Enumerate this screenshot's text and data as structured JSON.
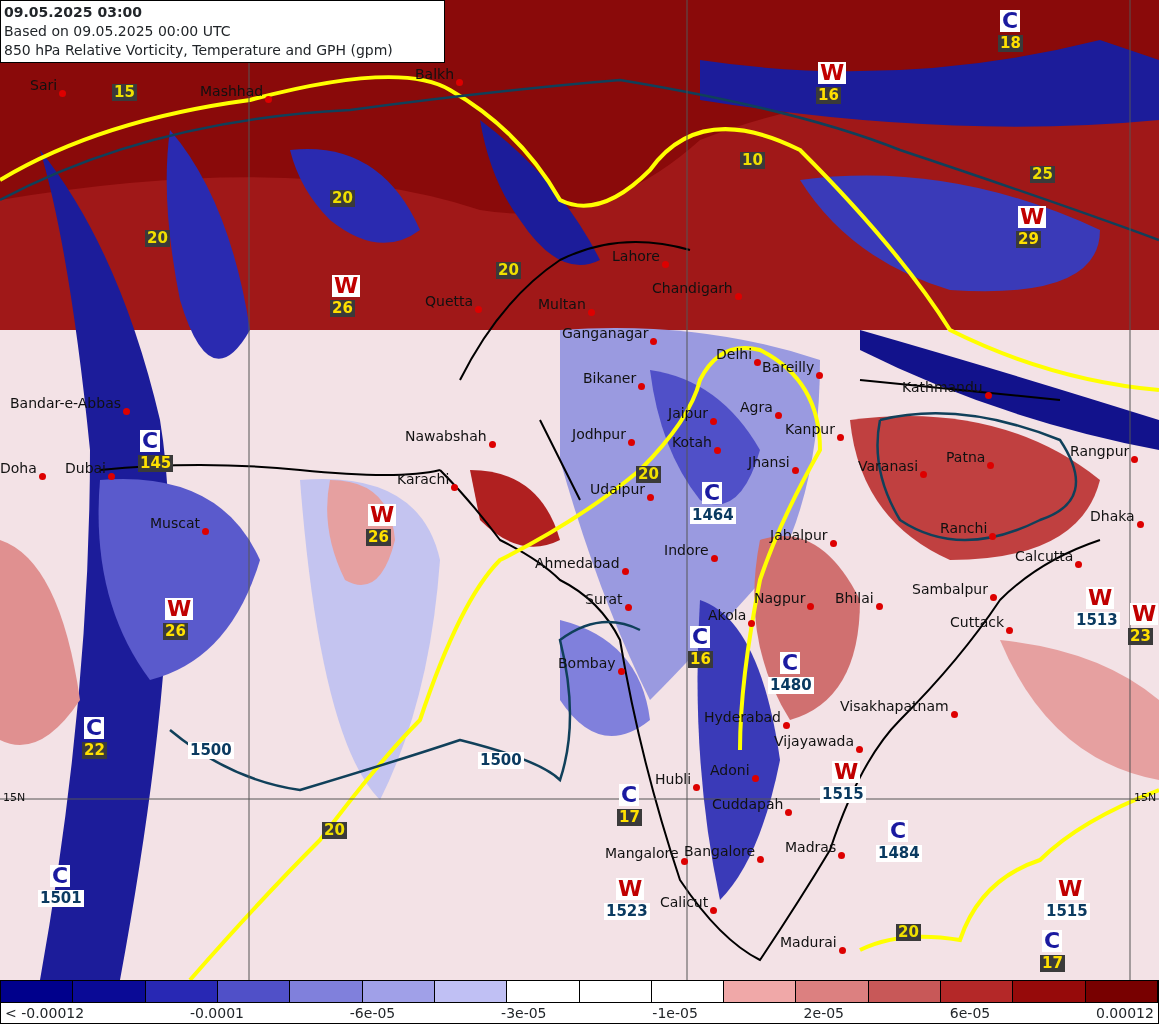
{
  "header": {
    "valid_time": "09.05.2025 03:00",
    "run": "Based on 09.05.2025 00:00 UTC",
    "field": "850 hPa Relative Vorticity, Temperature and GPH (gpm)"
  },
  "cities": [
    "Sari",
    "Mashhad",
    "Balkh",
    "Lahore",
    "Chandigarh",
    "Multan",
    "Quetta",
    "Ganganagar",
    "Bikaner",
    "Delhi",
    "Bareilly",
    "Jaipur",
    "Agra",
    "Kanpur",
    "Kathmandu",
    "Bandar-e-Abbas",
    "Nawabshah",
    "Jodhpur",
    "Kotah",
    "Jhansi",
    "Varanasi",
    "Patna",
    "Rangpur",
    "Doha",
    "Dubai",
    "Karachi",
    "Udaipur",
    "Dhaka",
    "Muscat",
    "Ranchi",
    "Jabalpur",
    "Indore",
    "Calcutta",
    "Ahmedabad",
    "Surat",
    "Nagpur",
    "Bhilai",
    "Sambalpur",
    "Akola",
    "Cuttack",
    "Bombay",
    "Visakhapatnam",
    "Hyderabad",
    "Vijayawada",
    "Adoni",
    "Hubli",
    "Cuddapah",
    "Mangalore",
    "Bangalore",
    "Madras",
    "Calicut",
    "Madurai"
  ],
  "systems": [
    {
      "kind": "cyclone",
      "letter": "C",
      "value": "18"
    },
    {
      "kind": "warm",
      "letter": "W",
      "value": "16"
    },
    {
      "kind": "warm",
      "letter": "W",
      "value": "29"
    },
    {
      "kind": "warm",
      "letter": "W",
      "value": "26"
    },
    {
      "kind": "cyclone",
      "letter": "C",
      "value": "145"
    },
    {
      "kind": "cyclone",
      "letter": "C",
      "value": "1464"
    },
    {
      "kind": "warm",
      "letter": "W",
      "value": "26"
    },
    {
      "kind": "warm",
      "letter": "W",
      "value": "26"
    },
    {
      "kind": "warm",
      "letter": "W",
      "value": "1513"
    },
    {
      "kind": "warm",
      "letter": "W",
      "value": "23"
    },
    {
      "kind": "cyclone",
      "letter": "C",
      "value": "16"
    },
    {
      "kind": "cyclone",
      "letter": "C",
      "value": "1480"
    },
    {
      "kind": "cyclone",
      "letter": "C",
      "value": "22"
    },
    {
      "kind": "warm",
      "letter": "W",
      "value": "1515"
    },
    {
      "kind": "cyclone",
      "letter": "C",
      "value": "17"
    },
    {
      "kind": "cyclone",
      "letter": "C",
      "value": "1484"
    },
    {
      "kind": "cyclone",
      "letter": "C",
      "value": "1501"
    },
    {
      "kind": "warm",
      "letter": "W",
      "value": "1523"
    },
    {
      "kind": "warm",
      "letter": "W",
      "value": "1515"
    },
    {
      "kind": "cyclone",
      "letter": "C",
      "value": "17"
    }
  ],
  "contour_labels": [
    {
      "kind": "temperature",
      "text": "15"
    },
    {
      "kind": "temperature",
      "text": "10"
    },
    {
      "kind": "temperature",
      "text": "25"
    },
    {
      "kind": "temperature",
      "text": "20"
    },
    {
      "kind": "temperature",
      "text": "20"
    },
    {
      "kind": "temperature",
      "text": "20"
    },
    {
      "kind": "temperature",
      "text": "20"
    },
    {
      "kind": "height",
      "text": "1500"
    },
    {
      "kind": "height",
      "text": "1500"
    },
    {
      "kind": "temperature",
      "text": "20"
    },
    {
      "kind": "temperature",
      "text": "20"
    }
  ],
  "latitude_labels": [
    "15N",
    "15N"
  ],
  "colorbar": {
    "bins": [
      {
        "color": "#00008c"
      },
      {
        "color": "#0a0a96"
      },
      {
        "color": "#2828b4"
      },
      {
        "color": "#5050c8"
      },
      {
        "color": "#8080dc"
      },
      {
        "color": "#a0a0e8"
      },
      {
        "color": "#c0c0f4"
      },
      {
        "color": "#ffffff"
      },
      {
        "color": "#ffffff"
      },
      {
        "color": "#ffffff"
      },
      {
        "color": "#f0a8a8"
      },
      {
        "color": "#dc8080"
      },
      {
        "color": "#c85858"
      },
      {
        "color": "#b42828"
      },
      {
        "color": "#960a0a"
      },
      {
        "color": "#780000"
      }
    ],
    "labels": [
      "< -0.00012",
      "-0.0001",
      "-6e-05",
      "-3e-05",
      "-1e-05",
      "2e-05",
      "6e-05",
      "0.00012"
    ]
  }
}
